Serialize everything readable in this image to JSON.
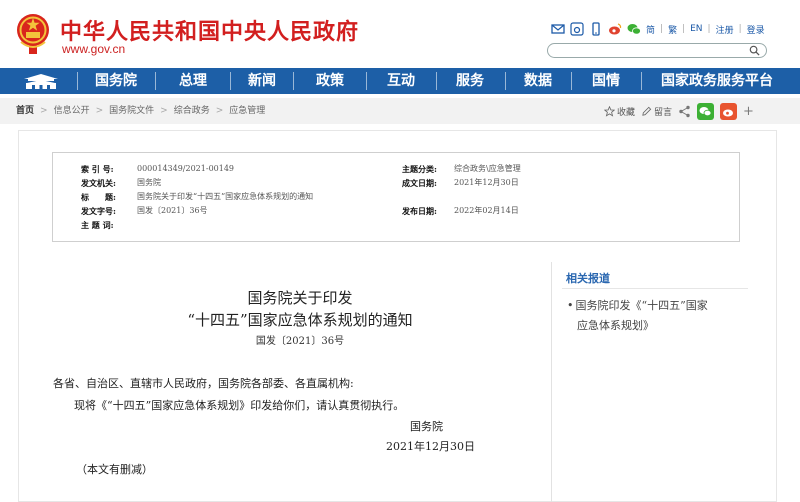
{
  "header": {
    "site_title": "中华人民共和国中央人民政府",
    "site_url": "www.gov.cn",
    "tools": {
      "lang_simplified": "简",
      "lang_traditional": "繁",
      "lang_en": "EN",
      "register": "注册",
      "login": "登录"
    },
    "search": {
      "placeholder": ""
    },
    "icons": [
      "mail-icon",
      "weibo-icon",
      "mobile-icon",
      "weibo-icon",
      "wechat-icon"
    ]
  },
  "nav": {
    "items": [
      "国务院",
      "总理",
      "新闻",
      "政策",
      "互动",
      "服务",
      "数据",
      "国情",
      "国家政务服务平台"
    ]
  },
  "breadcrumb": {
    "items": [
      "首页",
      "信息公开",
      "国务院文件",
      "综合政务",
      "应急管理"
    ],
    "actions": {
      "favorite": "收藏",
      "comment": "留言"
    }
  },
  "meta": {
    "index_label": "索 引 号:",
    "index_value": "000014349/2021-00149",
    "category_label": "主题分类:",
    "category_value": "综合政务\\应急管理",
    "issuer_label": "发文机关:",
    "issuer_value": "国务院",
    "written_date_label": "成文日期:",
    "written_date_value": "2021年12月30日",
    "title_label": "标　　题:",
    "title_value": "国务院关于印发“十四五”国家应急体系规划的通知",
    "doc_no_label": "发文字号:",
    "doc_no_value": "国发〔2021〕36号",
    "publish_date_label": "发布日期:",
    "publish_date_value": "2022年02月14日",
    "keywords_label": "主 题 词:"
  },
  "document": {
    "title_line1": "国务院关于印发",
    "title_line2": "“十四五”国家应急体系规划的通知",
    "doc_number": "国发〔2021〕36号",
    "salutation": "各省、自治区、直辖市人民政府，国务院各部委、各直属机构:",
    "body": "现将《“十四五”国家应急体系规划》印发给你们，请认真贯彻执行。",
    "signature_org": "国务院",
    "signature_date": "2021年12月30日",
    "note": "（本文有删减）"
  },
  "related": {
    "heading": "相关报道",
    "items": [
      {
        "line1": "国务院印发《“十四五”国家",
        "line2": "应急体系规划》"
      }
    ]
  },
  "colors": {
    "brand_red": "#d21f1f",
    "nav_blue": "#1d5fa7",
    "link_blue": "#1c5aa8",
    "related_blue": "#2a67b0"
  }
}
